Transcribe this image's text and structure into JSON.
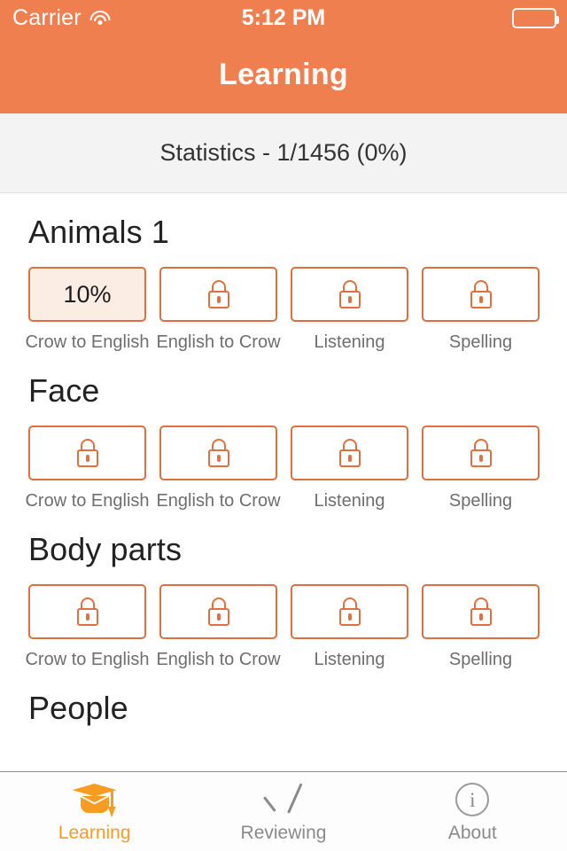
{
  "status_bar": {
    "carrier": "Carrier",
    "wifi_icon": "wifi-icon",
    "time": "5:12 PM",
    "battery_icon": "battery-icon"
  },
  "nav": {
    "title": "Learning"
  },
  "statistics": {
    "text": "Statistics - 1/1456 (0%)"
  },
  "theme": {
    "header_orange": "#EF7F4F",
    "border_orange": "#DE6F3E",
    "progress_fill": "#FBECE4",
    "tab_active": "#F79C21",
    "tab_inactive": "#8A8A8A",
    "stats_band": "#F3F3F3"
  },
  "lesson_labels": [
    "Crow to English",
    "English to Crow",
    "Listening",
    "Spelling"
  ],
  "sections": [
    {
      "title": "Animals 1",
      "tiles": [
        {
          "state": "progress",
          "value": "10%",
          "label": "Crow to English"
        },
        {
          "state": "locked",
          "value": "",
          "label": "English to Crow"
        },
        {
          "state": "locked",
          "value": "",
          "label": "Listening"
        },
        {
          "state": "locked",
          "value": "",
          "label": "Spelling"
        }
      ]
    },
    {
      "title": "Face",
      "tiles": [
        {
          "state": "locked",
          "value": "",
          "label": "Crow to English"
        },
        {
          "state": "locked",
          "value": "",
          "label": "English to Crow"
        },
        {
          "state": "locked",
          "value": "",
          "label": "Listening"
        },
        {
          "state": "locked",
          "value": "",
          "label": "Spelling"
        }
      ]
    },
    {
      "title": "Body parts",
      "tiles": [
        {
          "state": "locked",
          "value": "",
          "label": "Crow to English"
        },
        {
          "state": "locked",
          "value": "",
          "label": "English to Crow"
        },
        {
          "state": "locked",
          "value": "",
          "label": "Listening"
        },
        {
          "state": "locked",
          "value": "",
          "label": "Spelling"
        }
      ]
    },
    {
      "title": "People",
      "tiles": []
    }
  ],
  "tab_bar": {
    "items": [
      {
        "label": "Learning",
        "icon": "graduation-cap-icon",
        "active": true
      },
      {
        "label": "Reviewing",
        "icon": "check-icon",
        "active": false
      },
      {
        "label": "About",
        "icon": "info-circle-icon",
        "active": false
      }
    ]
  }
}
